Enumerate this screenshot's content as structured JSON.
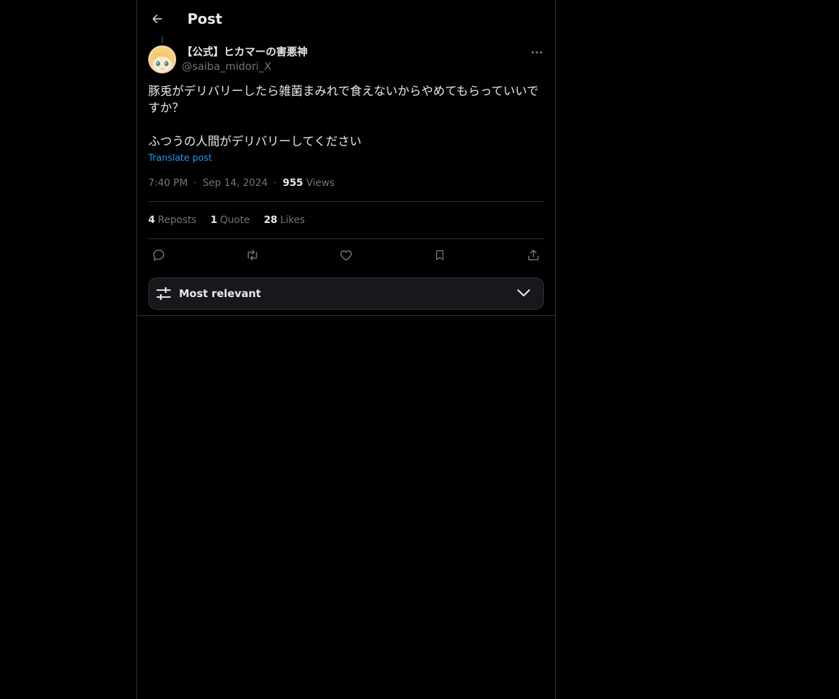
{
  "header": {
    "title": "Post",
    "back_icon": "arrow-left-icon"
  },
  "post": {
    "author": {
      "display_name": "【公式】ヒカマーの害悪神",
      "handle": "@saiba_midori_X",
      "avatar": "anime-character-avatar"
    },
    "more_icon": "more-horizontal-icon",
    "text_lines": [
      "豚兎がデリバリーしたら雑菌まみれで食えないからやめてもらっていいで",
      "すか？",
      "ふつうの人間がデリバリーしてください"
    ],
    "translate_label": "Translate post",
    "time": "7:40 PM",
    "separator": "·",
    "date": "Sep 14, 2024",
    "views_count": "955",
    "views_label": "Views"
  },
  "stats": {
    "reposts_count": "4",
    "reposts_label": "Reposts",
    "quote_count": "1",
    "quote_label": "Quote",
    "likes_count": "28",
    "likes_label": "Likes"
  },
  "actions": [
    "reply-icon",
    "repost-icon",
    "like-icon",
    "bookmark-icon",
    "share-icon"
  ],
  "sort": {
    "label": "Most relevant",
    "icon": "sliders-icon",
    "dropdown_icon": "chevron-down-icon"
  },
  "colors": {
    "background": "#000000",
    "text": "#e7e9ea",
    "secondary": "#71767b",
    "link": "#1d9bf0",
    "border": "#2f3336"
  }
}
